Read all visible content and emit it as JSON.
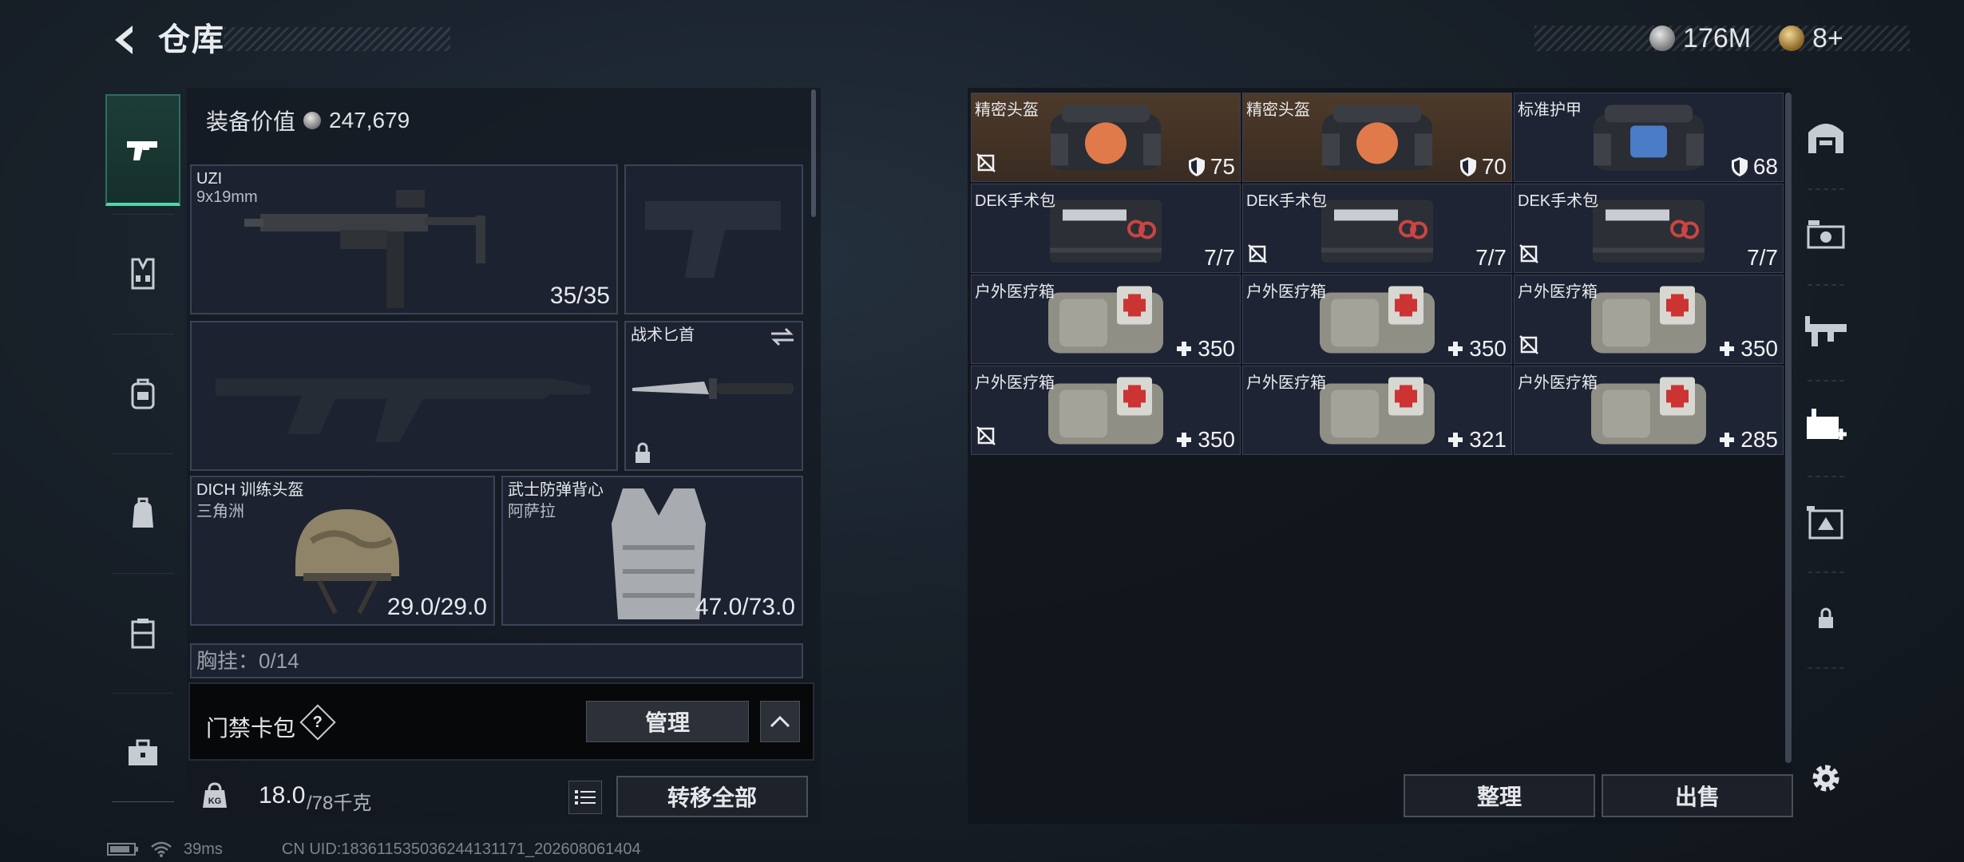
{
  "header": {
    "title": "仓库",
    "currency_silver": "176M",
    "currency_gold": "8+"
  },
  "equipment": {
    "value_label": "装备价值",
    "value": "247,679",
    "primary_weapon": {
      "name": "UZI",
      "caliber": "9x19mm",
      "ammo": "35/35"
    },
    "melee": {
      "name": "战术匕首"
    },
    "helmet": {
      "name": "DICH 训练头盔",
      "sub": "三角洲",
      "durability": "29.0/29.0"
    },
    "armor": {
      "name": "武士防弹背心",
      "sub": "阿萨拉",
      "durability": "47.0/73.0"
    },
    "chest_rig_label": "胸挂：0/14"
  },
  "card_pack": {
    "label": "门禁卡包",
    "help": "?",
    "manage_label": "管理"
  },
  "bottom": {
    "weight": "18.0",
    "weight_max": "/78千克",
    "transfer_all_label": "转移全部"
  },
  "storage": {
    "items": [
      {
        "name": "精密头盔",
        "value": "75",
        "kind": "helmet-case",
        "bg": "brown",
        "flag": true,
        "val_icon": "shield-icon"
      },
      {
        "name": "精密头盔",
        "value": "70",
        "kind": "helmet-case",
        "bg": "brown",
        "flag": false,
        "val_icon": "shield-icon"
      },
      {
        "name": "标准护甲",
        "value": "68",
        "kind": "armor-case",
        "bg": "blue",
        "flag": false,
        "val_icon": "shield-icon"
      },
      {
        "name": "DEK手术包",
        "value": "7/7",
        "kind": "surgery-kit",
        "bg": "blue",
        "flag": false,
        "val_icon": ""
      },
      {
        "name": "DEK手术包",
        "value": "7/7",
        "kind": "surgery-kit",
        "bg": "blue",
        "flag": true,
        "val_icon": ""
      },
      {
        "name": "DEK手术包",
        "value": "7/7",
        "kind": "surgery-kit",
        "bg": "blue",
        "flag": true,
        "val_icon": ""
      },
      {
        "name": "户外医疗箱",
        "value": "350",
        "kind": "medkit",
        "bg": "blue",
        "flag": false,
        "val_icon": "plus-icon"
      },
      {
        "name": "户外医疗箱",
        "value": "350",
        "kind": "medkit",
        "bg": "blue",
        "flag": false,
        "val_icon": "plus-icon"
      },
      {
        "name": "户外医疗箱",
        "value": "350",
        "kind": "medkit",
        "bg": "blue",
        "flag": true,
        "val_icon": "plus-icon"
      },
      {
        "name": "户外医疗箱",
        "value": "350",
        "kind": "medkit",
        "bg": "blue",
        "flag": true,
        "val_icon": "plus-icon"
      },
      {
        "name": "户外医疗箱",
        "value": "321",
        "kind": "medkit",
        "bg": "blue",
        "flag": false,
        "val_icon": "plus-icon"
      },
      {
        "name": "户外医疗箱",
        "value": "285",
        "kind": "medkit",
        "bg": "blue",
        "flag": false,
        "val_icon": "plus-icon"
      }
    ],
    "sort_label": "整理",
    "sell_label": "出售"
  },
  "footer": {
    "ping": "39ms",
    "uid": "CN UID:18361153503624413​1171_202608061404"
  },
  "colors": {
    "accent_green": "#4fd6a6",
    "item_bg_brown": "#4d3a2a",
    "item_bg_blue": "#1f2434"
  }
}
